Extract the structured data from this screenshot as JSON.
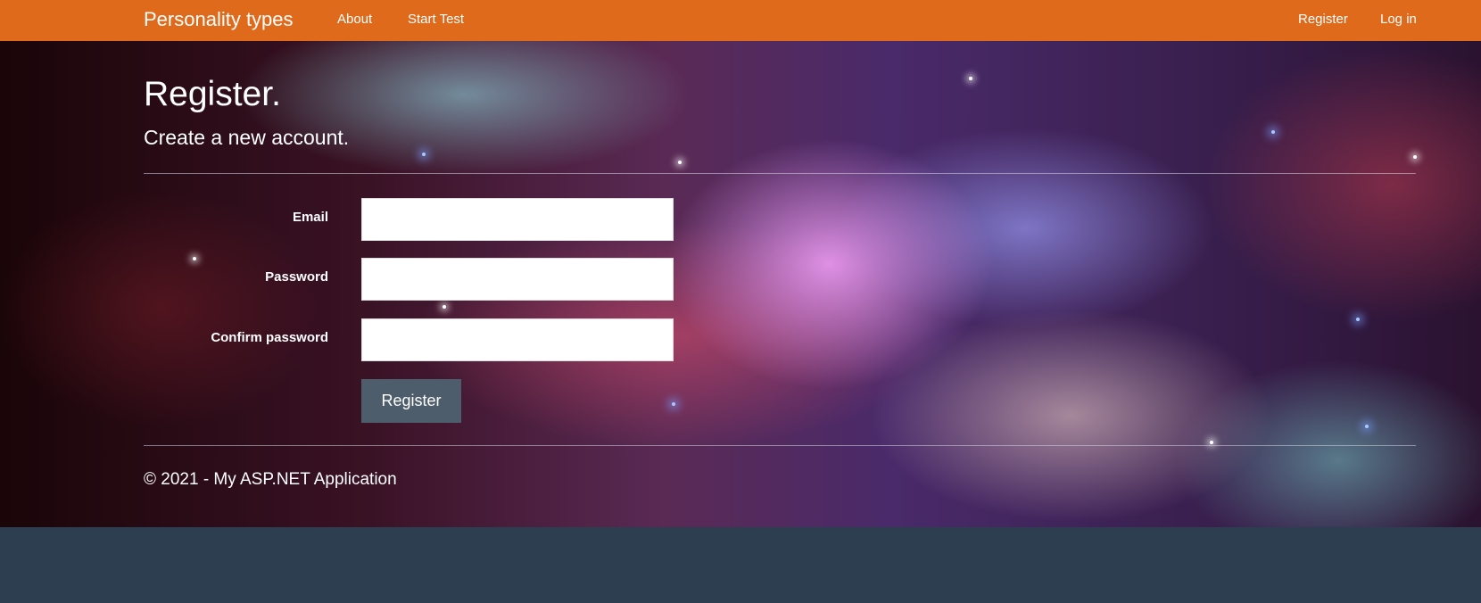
{
  "navbar": {
    "brand": "Personality types",
    "links": [
      "About",
      "Start Test"
    ],
    "right_links": [
      "Register",
      "Log in"
    ],
    "background": "#e06a1b"
  },
  "page": {
    "title": "Register.",
    "subtitle": "Create a new account."
  },
  "form": {
    "fields": [
      {
        "label": "Email",
        "value": ""
      },
      {
        "label": "Password",
        "value": ""
      },
      {
        "label": "Confirm password",
        "value": ""
      }
    ],
    "submit_label": "Register"
  },
  "footer": {
    "text": "© 2021 - My ASP.NET Application"
  },
  "colors": {
    "button": "#4e5d6c",
    "page_background": "#2c3e50"
  }
}
